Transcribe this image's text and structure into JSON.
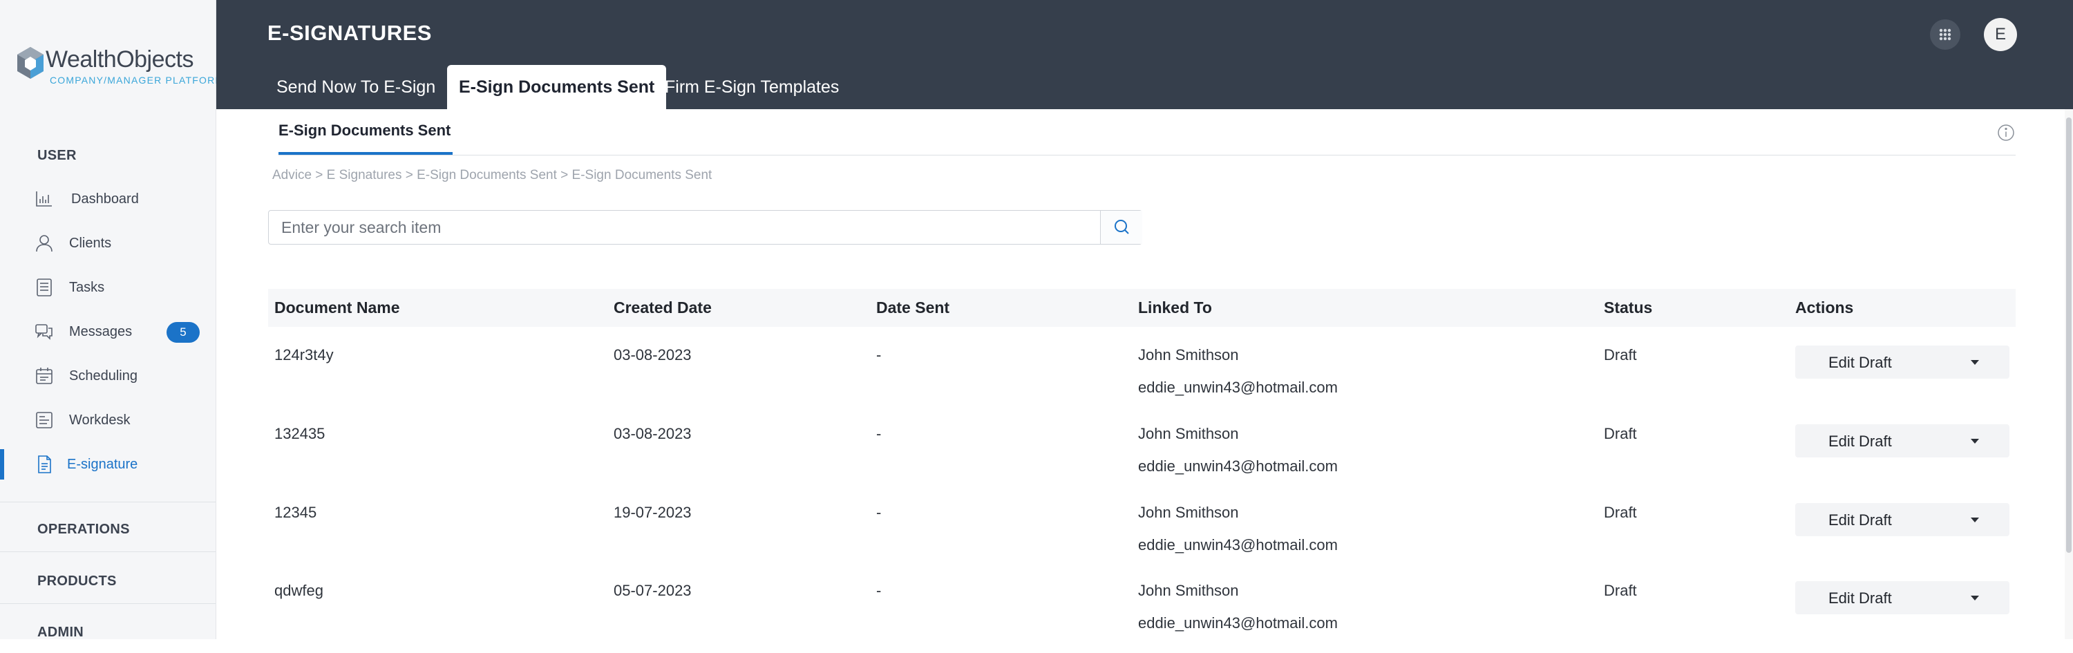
{
  "logo": {
    "name": "WealthObjects",
    "tagline": "COMPANY/MANAGER PLATFORM"
  },
  "sidebar": {
    "user_heading": "USER",
    "items": [
      {
        "label": "Dashboard",
        "icon": "bar-chart-icon"
      },
      {
        "label": "Clients",
        "icon": "person-icon"
      },
      {
        "label": "Tasks",
        "icon": "list-icon"
      },
      {
        "label": "Messages",
        "icon": "chat-icon",
        "badge": "5"
      },
      {
        "label": "Scheduling",
        "icon": "calendar-icon"
      },
      {
        "label": "Workdesk",
        "icon": "workdesk-icon"
      },
      {
        "label": "E-signature",
        "icon": "document-icon",
        "active": true
      }
    ],
    "sections": [
      "OPERATIONS",
      "PRODUCTS",
      "ADMIN"
    ]
  },
  "header": {
    "title": "E-SIGNATURES",
    "avatar_initial": "E",
    "tabs": [
      "Send Now To E-Sign",
      "E-Sign Documents Sent",
      "Firm E-Sign Templates"
    ],
    "active_tab": "E-Sign Documents Sent"
  },
  "subtab": {
    "label": "E-Sign Documents Sent"
  },
  "breadcrumb": "Advice  >  E Signatures  >  E-Sign Documents Sent > E-Sign Documents Sent",
  "search": {
    "placeholder": "Enter your search item",
    "value": ""
  },
  "table": {
    "columns": [
      "Document Name",
      "Created Date",
      "Date Sent",
      "Linked To",
      "Status",
      "Actions"
    ],
    "rows": [
      {
        "name": "124r3t4y",
        "created": "03-08-2023",
        "sent": "-",
        "linked_name": "John Smithson",
        "linked_email": "eddie_unwin43@hotmail.com",
        "status": "Draft",
        "action": "Edit Draft"
      },
      {
        "name": "132435",
        "created": "03-08-2023",
        "sent": "-",
        "linked_name": "John Smithson",
        "linked_email": "eddie_unwin43@hotmail.com",
        "status": "Draft",
        "action": "Edit Draft"
      },
      {
        "name": "12345",
        "created": "19-07-2023",
        "sent": "-",
        "linked_name": "John Smithson",
        "linked_email": "eddie_unwin43@hotmail.com",
        "status": "Draft",
        "action": "Edit Draft"
      },
      {
        "name": "qdwfeg",
        "created": "05-07-2023",
        "sent": "-",
        "linked_name": "John Smithson",
        "linked_email": "eddie_unwin43@hotmail.com",
        "status": "Draft",
        "action": "Edit Draft"
      }
    ]
  },
  "colors": {
    "accent": "#1b73c8",
    "header_bg": "#363f4c",
    "sidebar_bg": "#f5f6f8"
  }
}
